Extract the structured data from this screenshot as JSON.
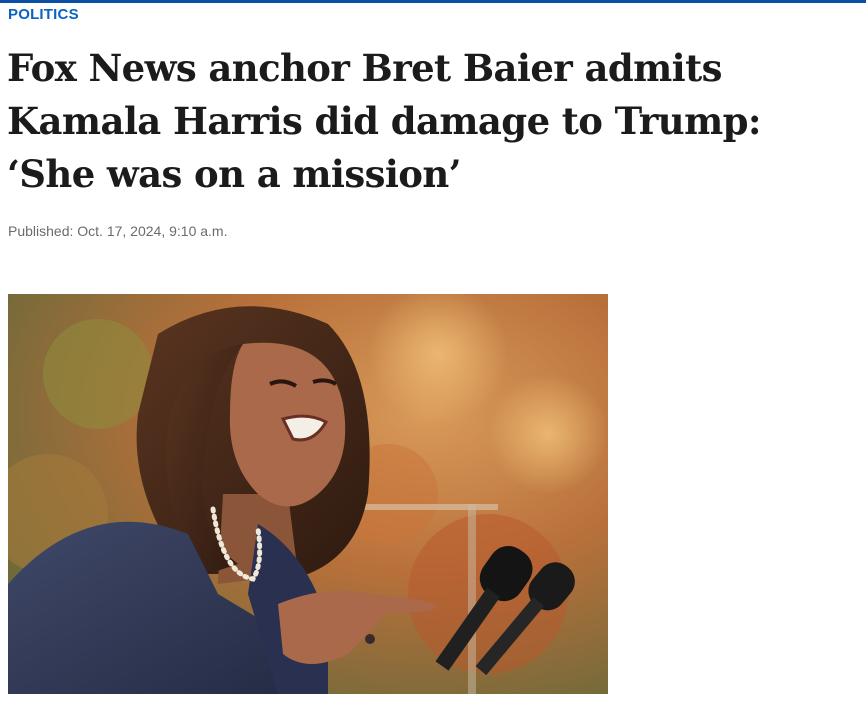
{
  "article": {
    "section": "POLITICS",
    "headline": "Fox News anchor Bret Baier admits Kamala Harris did damage to Trump: ‘She was on a mission’",
    "published": "Published: Oct. 17, 2024, 9:10 a.m."
  },
  "colors": {
    "accent": "#0a62c4",
    "rule": "#0a4fa6",
    "headline": "#1b1b1b",
    "meta": "#6b6b6b"
  }
}
